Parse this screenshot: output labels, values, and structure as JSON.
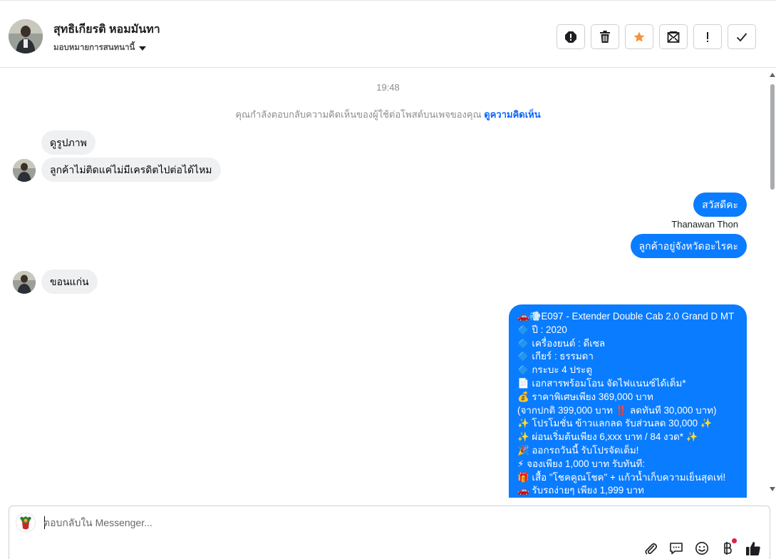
{
  "header": {
    "contact_name": "สุทธิเกียรติ หอมมันทา",
    "assign_label": "มอบหมายการสนทนานี้",
    "toolbar": [
      {
        "name": "report-icon"
      },
      {
        "name": "trash-icon"
      },
      {
        "name": "star-icon"
      },
      {
        "name": "mark-unread-icon"
      },
      {
        "name": "important-icon"
      },
      {
        "name": "check-icon"
      }
    ]
  },
  "conversation": {
    "timestamp": "19:48",
    "system_note": "คุณกำลังตอบกลับความคิดเห็นของผู้ใช้ต่อโพสต์บนเพจของคุณ",
    "system_link": "ดูความคิดเห็น",
    "messages": [
      {
        "dir": "in",
        "text": "ดูรูปภาพ"
      },
      {
        "dir": "in",
        "text": "ลูกค้าไม่ติดแค่ไม่มีเครดิตไปต่อได้ไหม"
      },
      {
        "dir": "out",
        "text": "สวัสดีคะ"
      },
      {
        "dir": "out",
        "text": "ลูกค้าอยู่จังหวัดอะไรคะ"
      },
      {
        "dir": "in",
        "text": "ขอนแก่น"
      }
    ],
    "sender_name": "Thanawan Thon",
    "long_message": [
      "🚗💨E097 - Extender Double Cab 2.0 Grand D MT",
      "🔷 ปี : 2020",
      "🔷 เครื่องยนต์ : ดีเซล",
      "🔷 เกียร์ : ธรรมดา",
      "🔷 กระบะ 4 ประตู",
      "📄 เอกสารพร้อมโอน จัดไฟแนนซ์ได้เต็ม*",
      "💰 ราคาพิเศษเพียง 369,000 บาท",
      "(จากปกติ 399,000 บาท ‼️ ลดทันที 30,000 บาท)",
      "✨ โปรโมชั่น ข้าวแลกลด รับส่วนลด 30,000 ✨",
      "✨ ผ่อนเริ่มต้นเพียง 6,xxx บาท / 84 งวด* ✨",
      "🎉 ออกรถวันนี้ รับโปรจัดเต็ม!",
      "⚡ จองเพียง 1,000 บาท รับทันที:",
      "🎁 เสื้อ \"โชคคูณโชค\" + แก้วน้ำเก็บความเย็นสุดเท่!",
      "🚗 รับรถง่ายๆ เพียง 1,999 บาท"
    ]
  },
  "composer": {
    "placeholder": "ตอบกลับใน Messenger...",
    "icons": [
      "attach-icon",
      "saved-replies-icon",
      "emoji-icon",
      "payment-icon",
      "like-icon"
    ]
  },
  "colors": {
    "outgoing_bubble": "#0a7cff",
    "incoming_bubble": "#eff0f2",
    "accent_link": "#0866ff",
    "star": "#f7923a"
  }
}
